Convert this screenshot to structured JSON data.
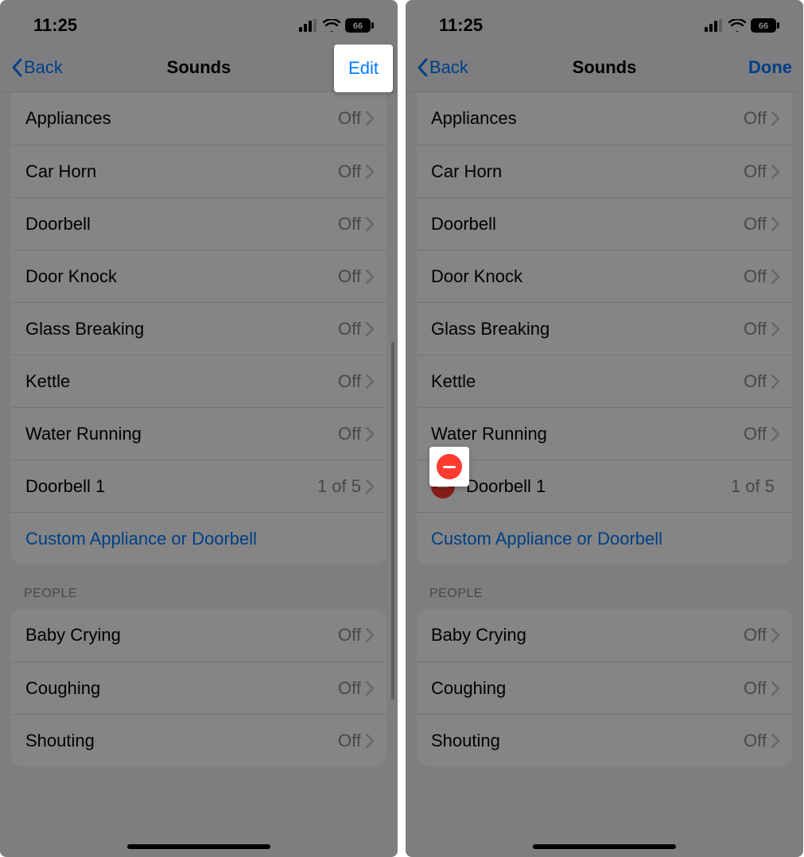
{
  "status": {
    "time": "11:25",
    "battery": "66"
  },
  "nav": {
    "back": "Back",
    "title": "Sounds",
    "edit": "Edit",
    "done": "Done"
  },
  "sounds_group": {
    "items": [
      {
        "label": "Appliances",
        "value": "Off",
        "chevron": true
      },
      {
        "label": "Car Horn",
        "value": "Off",
        "chevron": true
      },
      {
        "label": "Doorbell",
        "value": "Off",
        "chevron": true
      },
      {
        "label": "Door Knock",
        "value": "Off",
        "chevron": true
      },
      {
        "label": "Glass Breaking",
        "value": "Off",
        "chevron": true
      },
      {
        "label": "Kettle",
        "value": "Off",
        "chevron": true
      },
      {
        "label": "Water Running",
        "value": "Off",
        "chevron": true
      },
      {
        "label": "Doorbell 1",
        "value": "1 of 5",
        "chevron": true,
        "deletable": true
      }
    ],
    "custom_link": "Custom Appliance or Doorbell"
  },
  "people_group": {
    "header": "PEOPLE",
    "items": [
      {
        "label": "Baby Crying",
        "value": "Off",
        "chevron": true
      },
      {
        "label": "Coughing",
        "value": "Off",
        "chevron": true
      },
      {
        "label": "Shouting",
        "value": "Off",
        "chevron": true
      }
    ]
  },
  "screens": [
    {
      "mode": "view",
      "right_button": "edit",
      "highlight": "edit"
    },
    {
      "mode": "edit",
      "right_button": "done",
      "highlight": "delete"
    }
  ]
}
